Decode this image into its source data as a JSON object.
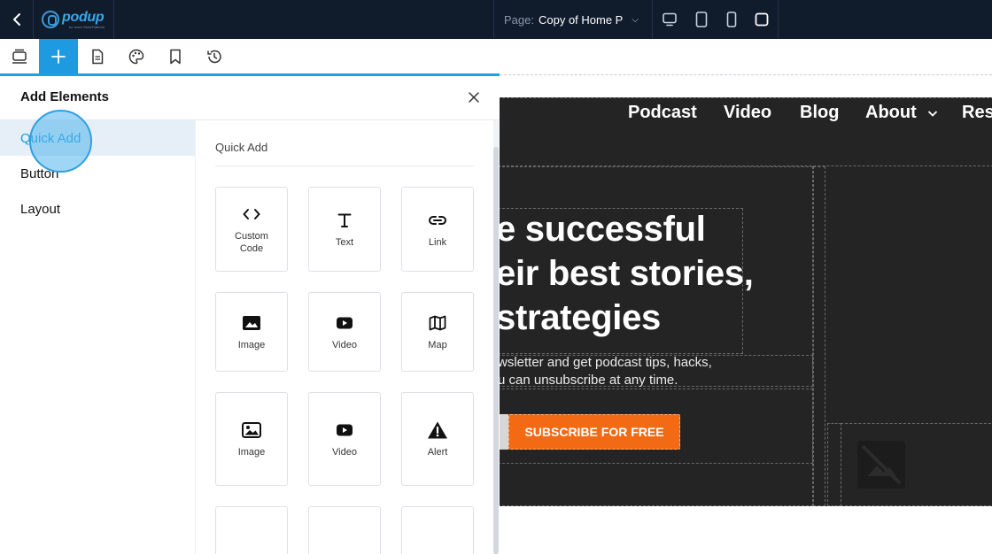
{
  "topbar": {
    "logo_name": "podup",
    "logo_tag": "for more StoreFlatform",
    "page_label": "Page:",
    "page_value": "Copy of Home P",
    "devices": [
      "desktop-icon",
      "tablet-icon",
      "mobile-icon",
      "square-icon"
    ]
  },
  "tools": [
    "sections-icon",
    "add-icon",
    "pages-icon",
    "palette-icon",
    "bookmark-icon",
    "history-icon"
  ],
  "panel": {
    "title": "Add Elements",
    "categories": [
      "Quick Add",
      "Button",
      "Layout"
    ],
    "section_title": "Quick Add",
    "tiles": [
      {
        "label": "Custom Code",
        "icon": "code-icon"
      },
      {
        "label": "Text",
        "icon": "text-icon"
      },
      {
        "label": "Link",
        "icon": "link-icon"
      },
      {
        "label": "Image",
        "icon": "image-icon"
      },
      {
        "label": "Video",
        "icon": "video-icon"
      },
      {
        "label": "Map",
        "icon": "map-icon"
      },
      {
        "label": "Image",
        "icon": "gallery-icon"
      },
      {
        "label": "Video",
        "icon": "video-icon"
      },
      {
        "label": "Alert",
        "icon": "alert-icon"
      }
    ]
  },
  "canvas": {
    "nav": [
      "Podcast",
      "Video",
      "Blog",
      "About",
      "Res"
    ],
    "headline": [
      "e successful",
      "eir best stories,",
      "strategies"
    ],
    "sub": [
      "wsletter and get podcast tips, hacks,",
      "u can unsubscribe at any time."
    ],
    "cta": "SUBSCRIBE FOR FREE"
  },
  "colors": {
    "topbar_bg": "#101b2c",
    "accent": "#1e9be0",
    "canvas_bg": "#242424",
    "cta": "#f26a14"
  }
}
